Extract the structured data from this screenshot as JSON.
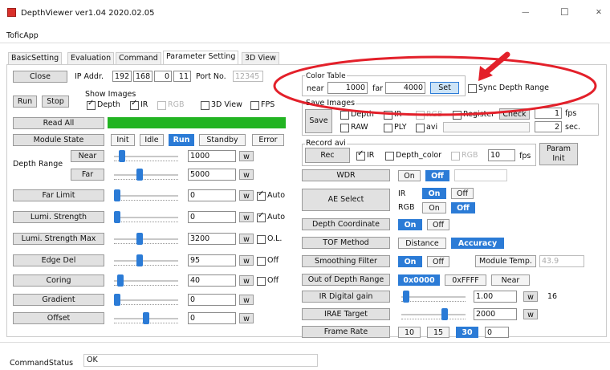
{
  "window": {
    "title": "DepthViewer ver1.04 2020.02.05",
    "min": "—",
    "max": "☐",
    "close": "✕"
  },
  "menu": {
    "item": "ToficApp"
  },
  "tabs": [
    "BasicSetting",
    "Evaluation",
    "Command",
    "Parameter Setting",
    "3D View"
  ],
  "left": {
    "close": "Close",
    "ip_label": "IP Addr.",
    "ip": [
      "192",
      "168",
      "0",
      "11"
    ],
    "port_label": "Port No.",
    "port": "12345",
    "run": "Run",
    "stop": "Stop",
    "show_images": "Show Images",
    "cb_depth": "Depth",
    "cb_ir": "IR",
    "cb_rgb": "RGB",
    "cb_3dview": "3D View",
    "cb_fps": "FPS",
    "read_all": "Read All",
    "module_state": "Module State",
    "ms_init": "Init",
    "ms_idle": "Idle",
    "ms_run": "Run",
    "ms_standby": "Standby",
    "ms_error": "Error",
    "depth_range": "Depth Range",
    "near": "Near",
    "far": "Far",
    "near_val": "1000",
    "far_val": "5000",
    "far_limit": "Far Limit",
    "far_limit_val": "0",
    "lumi": "Lumi. Strength",
    "lumi_val": "0",
    "auto": "Auto",
    "lumi_max": "Lumi. Strength Max",
    "lumi_max_val": "3200",
    "ol": "O.L.",
    "edge": "Edge Del",
    "edge_val": "95",
    "coring": "Coring",
    "coring_val": "40",
    "off": "Off",
    "gradient": "Gradient",
    "gradient_val": "0",
    "offset": "Offset",
    "offset_val": "0",
    "w": "w"
  },
  "right": {
    "color_table": "Color Table",
    "near": "near",
    "near_val": "1000",
    "far": "far",
    "far_val": "4000",
    "set": "Set",
    "sync": "Sync Depth Range",
    "save_images": "Save Images",
    "save": "Save",
    "cb_depth": "Depth",
    "cb_ir": "IR",
    "cb_rgb": "RGB",
    "cb_register": "Register",
    "check": "Check",
    "cb_raw": "RAW",
    "cb_ply": "PLY",
    "cb_avi": "avi",
    "fps_val": "1",
    "fps": "fps",
    "sec_val": "2",
    "sec": "sec.",
    "record_avi": "Record avi",
    "rec": "Rec",
    "rec_ir": "IR",
    "rec_depth_color": "Depth_color",
    "rec_rgb": "RGB",
    "rec_fps_val": "10",
    "rec_fps": "fps",
    "param_init": "Param Init",
    "wdr": "WDR",
    "on": "On",
    "off": "Off",
    "ae_select": "AE Select",
    "ae_ir": "IR",
    "ae_rgb": "RGB",
    "depth_coord": "Depth Coordinate",
    "tof_method": "TOF Method",
    "distance": "Distance",
    "accuracy": "Accuracy",
    "smoothing": "Smoothing Filter",
    "module_temp": "Module Temp.",
    "module_temp_val": "43.9",
    "out_depth": "Out of Depth Range",
    "hex0": "0x0000",
    "hexf": "0xFFFF",
    "near_btn": "Near",
    "ir_gain": "IR Digital gain",
    "ir_gain_val": "1.00",
    "ir_gain_num": "16",
    "irae": "IRAE Target",
    "irae_val": "2000",
    "frame_rate": "Frame Rate",
    "fr": [
      "10",
      "15",
      "30"
    ],
    "fr_val": "0"
  },
  "status": {
    "label": "CommandStatus",
    "value": "OK"
  },
  "colors": {
    "accent": "#2b7bd6",
    "progress": "#22b422",
    "annotation": "#e3202a"
  }
}
